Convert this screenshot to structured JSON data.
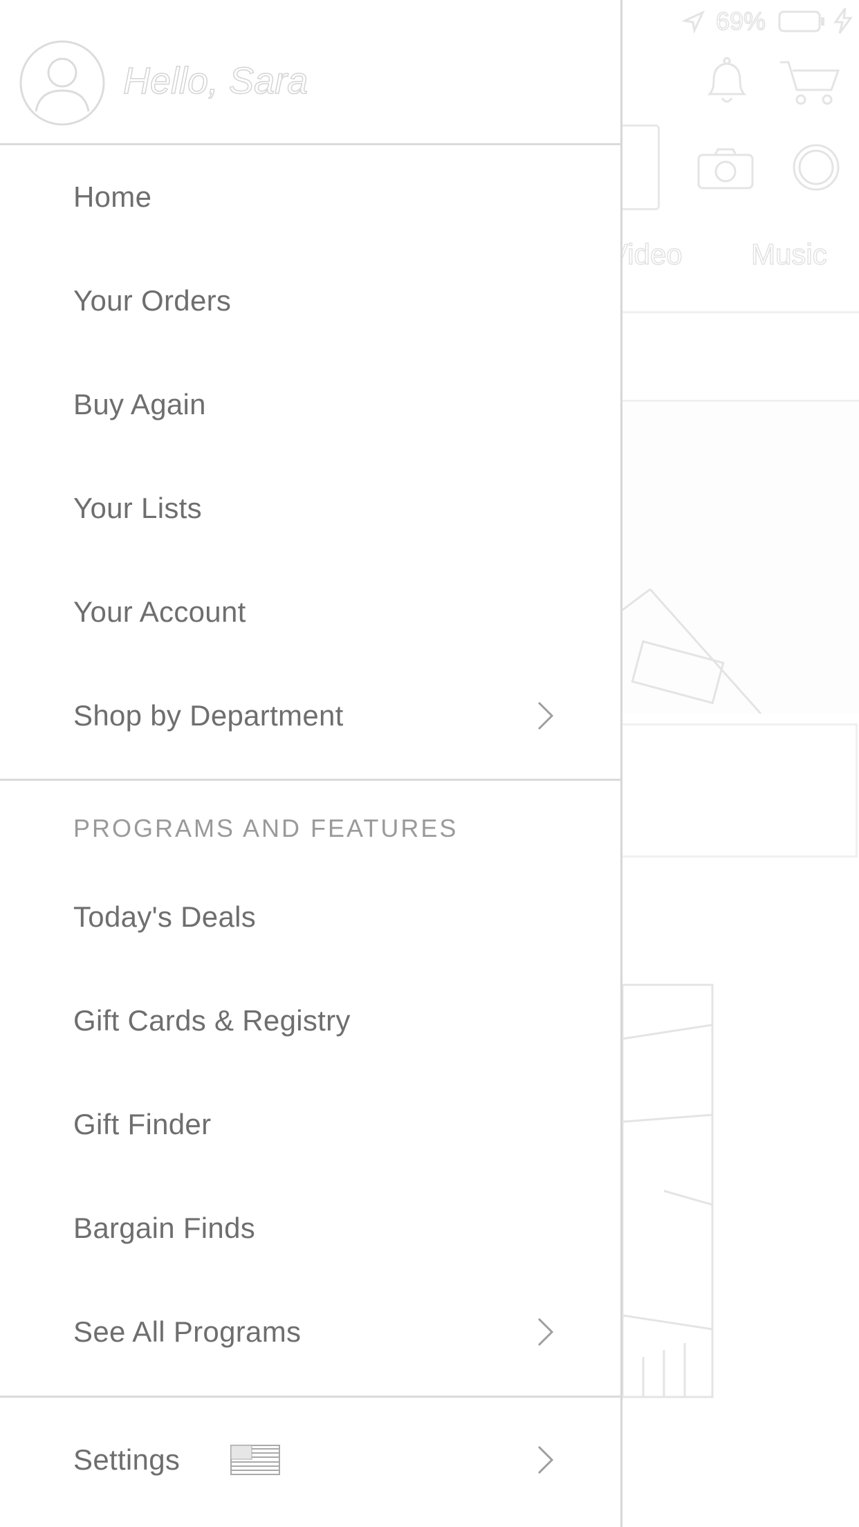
{
  "status_bar": {
    "battery_percent": "69%"
  },
  "background": {
    "tabs": [
      {
        "label": "Video"
      },
      {
        "label": "Music"
      }
    ],
    "icons": [
      "location-arrow-icon",
      "battery-icon",
      "charging-bolt-icon",
      "bell-icon",
      "cart-icon",
      "camera-icon",
      "voice-assistant-icon"
    ]
  },
  "drawer": {
    "greeting": "Hello, Sara",
    "avatar_icon": "user-avatar-icon",
    "primary_items": [
      {
        "label": "Home",
        "has_chevron": false
      },
      {
        "label": "Your Orders",
        "has_chevron": false
      },
      {
        "label": "Buy Again",
        "has_chevron": false
      },
      {
        "label": "Your Lists",
        "has_chevron": false
      },
      {
        "label": "Your Account",
        "has_chevron": false
      },
      {
        "label": "Shop by Department",
        "has_chevron": true
      }
    ],
    "programs_heading": "PROGRAMS AND FEATURES",
    "program_items": [
      {
        "label": "Today's Deals",
        "has_chevron": false
      },
      {
        "label": "Gift Cards & Registry",
        "has_chevron": false
      },
      {
        "label": "Gift Finder",
        "has_chevron": false
      },
      {
        "label": "Bargain Finds",
        "has_chevron": false
      },
      {
        "label": "See All Programs",
        "has_chevron": true
      }
    ],
    "settings": {
      "label": "Settings",
      "flag_icon": "us-flag-icon",
      "has_chevron": true
    }
  },
  "colors": {
    "text": "#6e6e6e",
    "heading": "#9a9a9a",
    "divider": "#dadada",
    "ghost": "#e2e2e2"
  }
}
